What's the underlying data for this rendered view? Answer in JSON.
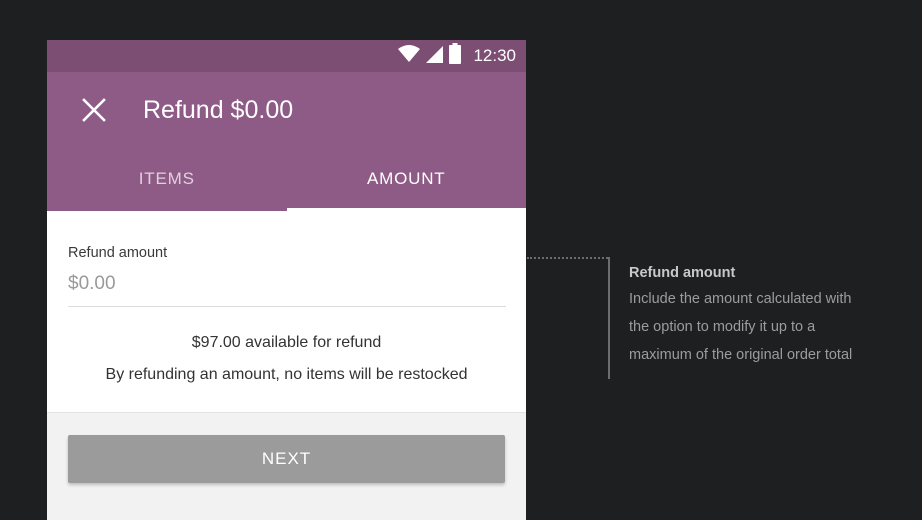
{
  "status_bar": {
    "time": "12:30",
    "icons": [
      "wifi-icon",
      "signal-icon",
      "battery-icon"
    ]
  },
  "app_bar": {
    "title": "Refund $0.00",
    "close_icon": "close-icon",
    "color": "#8e5b86"
  },
  "tabs": [
    {
      "label": "ITEMS",
      "active": false
    },
    {
      "label": "AMOUNT",
      "active": true
    }
  ],
  "refund_field": {
    "label": "Refund amount",
    "placeholder": "$0.00"
  },
  "info": {
    "available": "$97.00 available for refund",
    "note": "By refunding an amount, no items will be restocked"
  },
  "next_button": {
    "label": "NEXT",
    "enabled": false
  },
  "annotation": {
    "title": "Refund amount",
    "lines": [
      "Include the amount calculated with",
      "the option to modify it up to a",
      "maximum of the original order total"
    ]
  }
}
